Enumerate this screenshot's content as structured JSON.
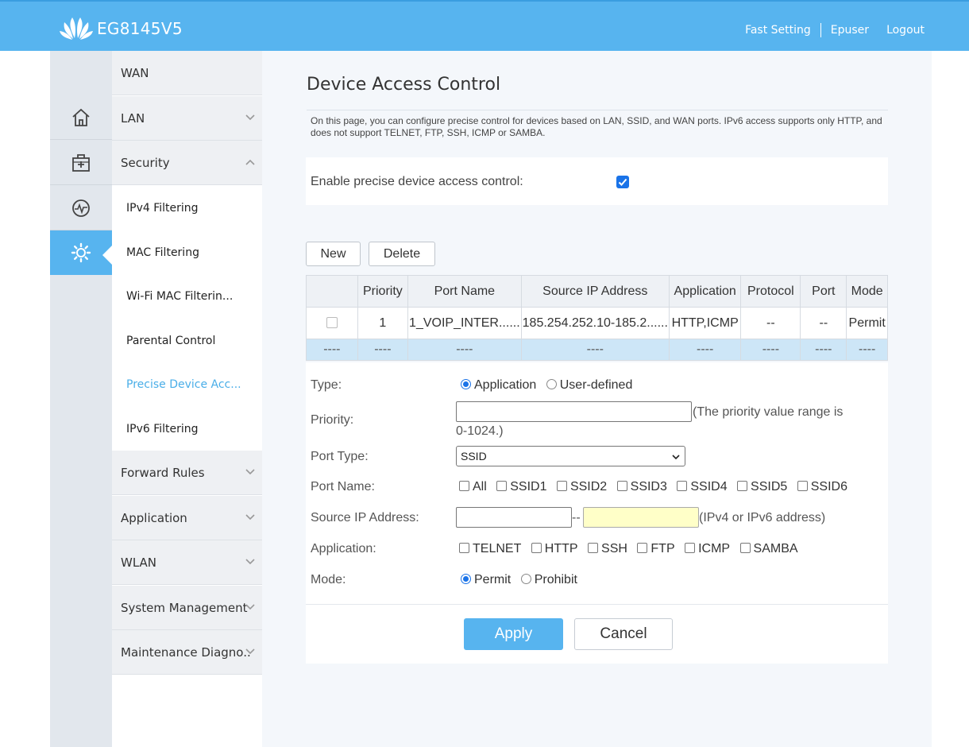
{
  "header": {
    "brand": "EG8145V5",
    "links": [
      "Fast Setting",
      "Epuser",
      "Logout"
    ]
  },
  "rail": {
    "icons": [
      "home-icon",
      "toolbox-icon",
      "monitor-icon",
      "gear-icon"
    ],
    "active": "gear-icon"
  },
  "menu": {
    "wan": "WAN",
    "lan": "LAN",
    "security": "Security",
    "sub_items": [
      "IPv4 Filtering",
      "MAC Filtering",
      "Wi-Fi MAC Filterin...",
      "Parental Control",
      "Precise Device Acc...",
      "IPv6 Filtering"
    ],
    "active_sub": "Precise Device Acc...",
    "after": [
      "Forward Rules",
      "Application",
      "WLAN",
      "System Management",
      "Maintenance Diagno.."
    ]
  },
  "page": {
    "title": "Device Access Control",
    "description": "On this page, you can configure precise control for devices based on LAN, SSID, and WAN ports. IPv6 access supports only HTTP, and does not support TELNET, FTP, SSH, ICMP or SAMBA.",
    "enable_label": "Enable precise device access control:",
    "enable_checked": true,
    "new_button": "New",
    "delete_button": "Delete"
  },
  "table": {
    "columns": [
      "",
      "Priority",
      "Port Name",
      "Source IP Address",
      "Application",
      "Protocol",
      "Port",
      "Mode"
    ],
    "row": [
      "",
      "1",
      "1_VOIP_INTER......",
      "185.254.252.10-185.2......",
      "HTTP,ICMP",
      "--",
      "--",
      "Permit"
    ],
    "empty_row": [
      "----",
      "----",
      "----",
      "----",
      "----",
      "----",
      "----",
      "----"
    ]
  },
  "form": {
    "type_label": "Type:",
    "type_options": [
      "Application",
      "User-defined"
    ],
    "type_selected": "Application",
    "priority_label": "Priority:",
    "priority_hint_a": "(The priority value range is",
    "priority_hint_b": "0-1024.)",
    "port_type_label": "Port Type:",
    "port_type_value": "SSID",
    "port_name_label": "Port Name:",
    "port_names": [
      "All",
      "SSID1",
      "SSID2",
      "SSID3",
      "SSID4",
      "SSID5",
      "SSID6"
    ],
    "source_ip_label": "Source IP Address:",
    "source_ip_sep": "--",
    "source_ip_hint": "(IPv4 or IPv6 address)",
    "application_label": "Application:",
    "applications": [
      "TELNET",
      "HTTP",
      "SSH",
      "FTP",
      "ICMP",
      "SAMBA"
    ],
    "mode_label": "Mode:",
    "mode_options": [
      "Permit",
      "Prohibit"
    ],
    "mode_selected": "Permit",
    "apply_button": "Apply",
    "cancel_button": "Cancel"
  },
  "colors": {
    "header_blue": "#57b4ef",
    "active_link": "#4aaee8",
    "checkbox_blue": "#1a73e8",
    "empty_row_bg": "#cde6f7"
  }
}
